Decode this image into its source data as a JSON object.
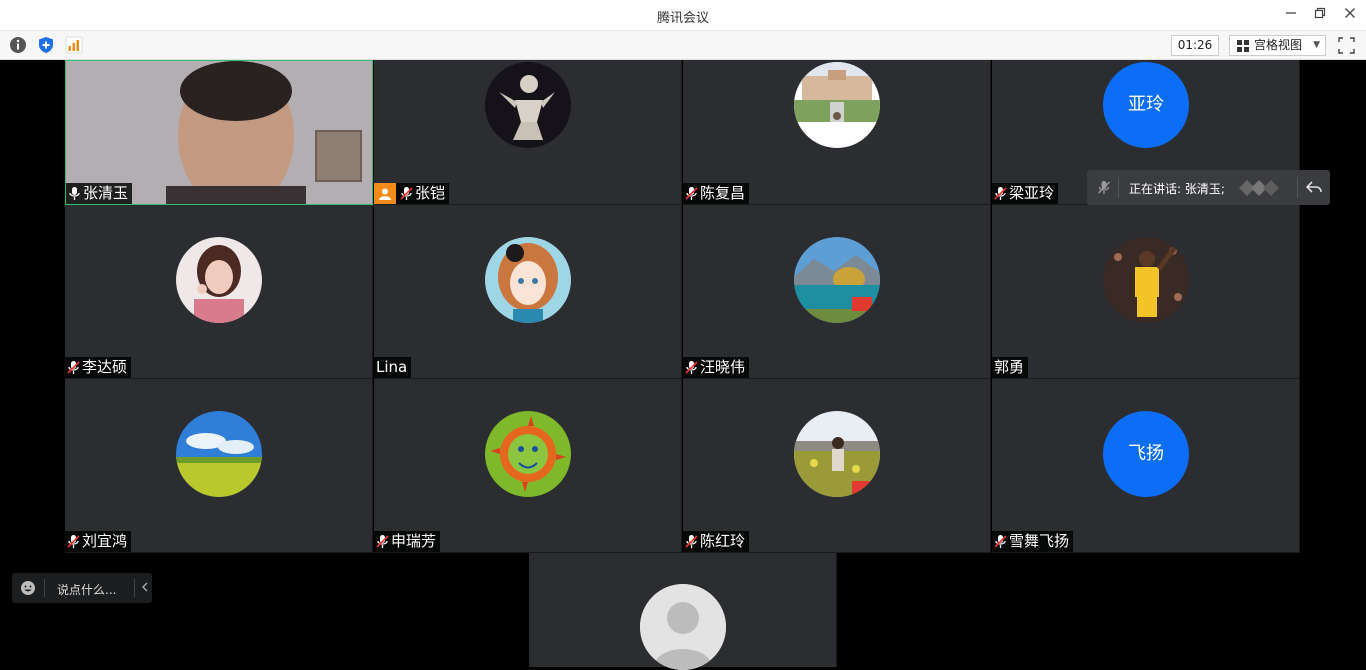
{
  "window": {
    "title": "腾讯会议"
  },
  "toolbar": {
    "timer": "01:26",
    "view_label": "宫格视图",
    "icons": [
      "info-icon",
      "shield-icon",
      "signal-bars-icon",
      "grid-view-icon",
      "fullscreen-icon"
    ]
  },
  "participants": [
    {
      "name": "张清玉",
      "mic": "on",
      "video": true
    },
    {
      "name": "张铠",
      "mic": "muted",
      "host": true,
      "avatar": "taichi-figure"
    },
    {
      "name": "陈复昌",
      "mic": "muted",
      "avatar": "building-photo"
    },
    {
      "name": "梁亚玲",
      "mic": "muted",
      "avatar_text": "亚玲"
    },
    {
      "name": "李达硕",
      "mic": "muted",
      "avatar": "woman-photo"
    },
    {
      "name": "Lina",
      "mic": "none",
      "avatar": "anime-girl"
    },
    {
      "name": "汪晓伟",
      "mic": "muted",
      "avatar": "lake-landscape"
    },
    {
      "name": "郭勇",
      "mic": "none",
      "avatar": "basketball-player"
    },
    {
      "name": "刘宜鸿",
      "mic": "muted",
      "avatar": "meadow-sky"
    },
    {
      "name": "申瑞芳",
      "mic": "muted",
      "avatar": "sun-drawing"
    },
    {
      "name": "陈红玲",
      "mic": "muted",
      "avatar": "flower-field-person"
    },
    {
      "name": "雪舞飞扬",
      "mic": "muted",
      "avatar_text": "飞扬"
    },
    {
      "name": "",
      "mic": "none",
      "avatar": "default-person"
    }
  ],
  "speaking": {
    "label": "正在讲话: 张清玉;"
  },
  "chat": {
    "placeholder": "说点什么..."
  },
  "colors": {
    "accent": "#0c6ef6",
    "tile_bg": "#2b2d30",
    "active_border": "#2fbf71",
    "host_badge": "#f28b1c"
  }
}
